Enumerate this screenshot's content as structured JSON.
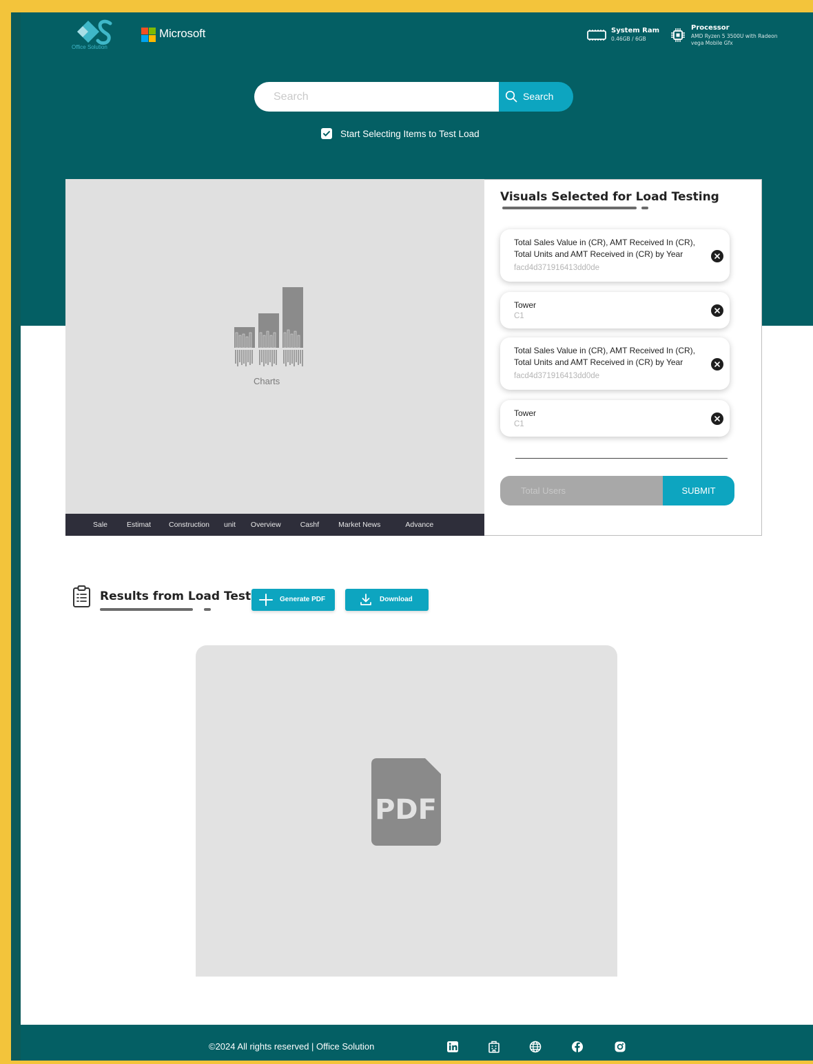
{
  "brand": {
    "logo_caption": "Office Solution",
    "partner": "Microsoft",
    "colors": {
      "hero": "#045f64",
      "accent": "#0da5c0",
      "frame": "#f3c43b"
    }
  },
  "system": {
    "ram_label": "System Ram",
    "ram_value": "0.46GB / 6GB",
    "processor_label": "Processor",
    "processor_value": "AMD Ryzen 5 3500U with Radeon vega Mobile Gfx"
  },
  "search": {
    "placeholder": "Search",
    "button_label": "Search"
  },
  "load_toggle": {
    "label": "Start Selecting Items to Test Load",
    "checked": true
  },
  "chart_preview": {
    "caption": "Charts",
    "tabs": [
      "Sale",
      "Estimat",
      "Construction",
      "unit",
      "Overview",
      "Cashf",
      "Market News",
      "Advance"
    ]
  },
  "selected_visuals": {
    "title": "Visuals Selected for Load Testing",
    "items": [
      {
        "title": "Total Sales Value in (CR), AMT Received In (CR), Total Units and AMT Received in (CR) by Year",
        "sub": "facd4d371916413dd0de"
      },
      {
        "title": "Tower",
        "sub": "C1"
      },
      {
        "title": "Total Sales Value in (CR), AMT Received In (CR), Total Units and AMT Received in (CR) by Year",
        "sub": "facd4d371916413dd0de"
      },
      {
        "title": "Tower",
        "sub": "C1"
      }
    ],
    "users_placeholder": "Total Users",
    "submit_label": "SUBMIT"
  },
  "results": {
    "title": "Results from Load Test",
    "generate_label": "Generate PDF",
    "download_label": "Download",
    "pdf_icon_text": "PDF"
  },
  "footer": {
    "copyright": "©2024 All rights reserved | Office Solution",
    "social_icons": [
      "linkedin-icon",
      "building-icon",
      "globe-icon",
      "facebook-icon",
      "instagram-icon"
    ]
  }
}
